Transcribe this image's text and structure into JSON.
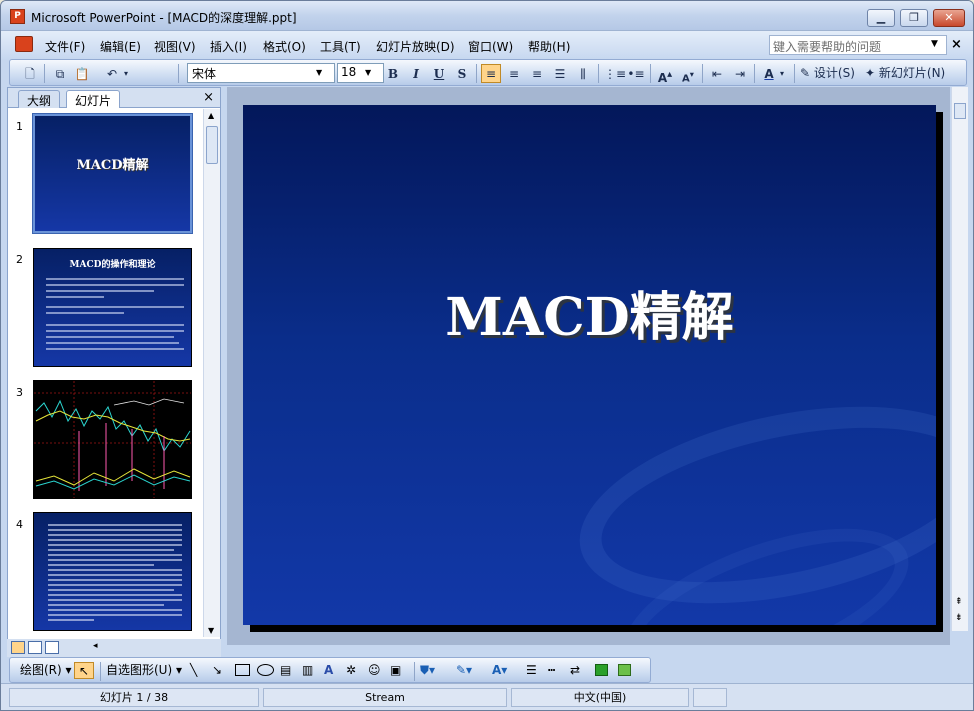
{
  "window": {
    "title": "Microsoft PowerPoint - [MACD的深度理解.ppt]",
    "app_icon": "powerpoint-icon",
    "controls": {
      "minimize": "minimize-icon",
      "maximize": "restore-icon",
      "close": "close-icon"
    }
  },
  "menu": {
    "items": [
      "文件(F)",
      "编辑(E)",
      "视图(V)",
      "插入(I)",
      "格式(O)",
      "工具(T)",
      "幻灯片放映(D)",
      "窗口(W)",
      "帮助(H)"
    ],
    "help_placeholder": "键入需要帮助的问题",
    "close_glyph": "×"
  },
  "toolbar": {
    "font": "宋体",
    "size": "18",
    "bold": "B",
    "italic": "I",
    "underline": "U",
    "shadow": "S",
    "font_color": "A",
    "design_label": "设计(S)",
    "new_slide_label": "新幻灯片(N)"
  },
  "outline_pane": {
    "tabs": [
      "大纲",
      "幻灯片"
    ],
    "active_tab": "幻灯片",
    "close_glyph": "×",
    "slides": [
      {
        "number": "1",
        "title": "MACD精解",
        "selected": true
      },
      {
        "number": "2",
        "title": "MACD的操作和理论"
      },
      {
        "number": "3",
        "title": ""
      },
      {
        "number": "4",
        "title": ""
      }
    ]
  },
  "slide": {
    "title": "MACD精解",
    "background_top": "#03175a",
    "background_bottom": "#1238a8"
  },
  "drawing_toolbar": {
    "draw_label": "绘图(R)",
    "autoshape_label": "自选图形(U)"
  },
  "status": {
    "slide_position": "幻灯片 1 / 38",
    "design_name": "Stream",
    "language": "中文(中国)"
  }
}
